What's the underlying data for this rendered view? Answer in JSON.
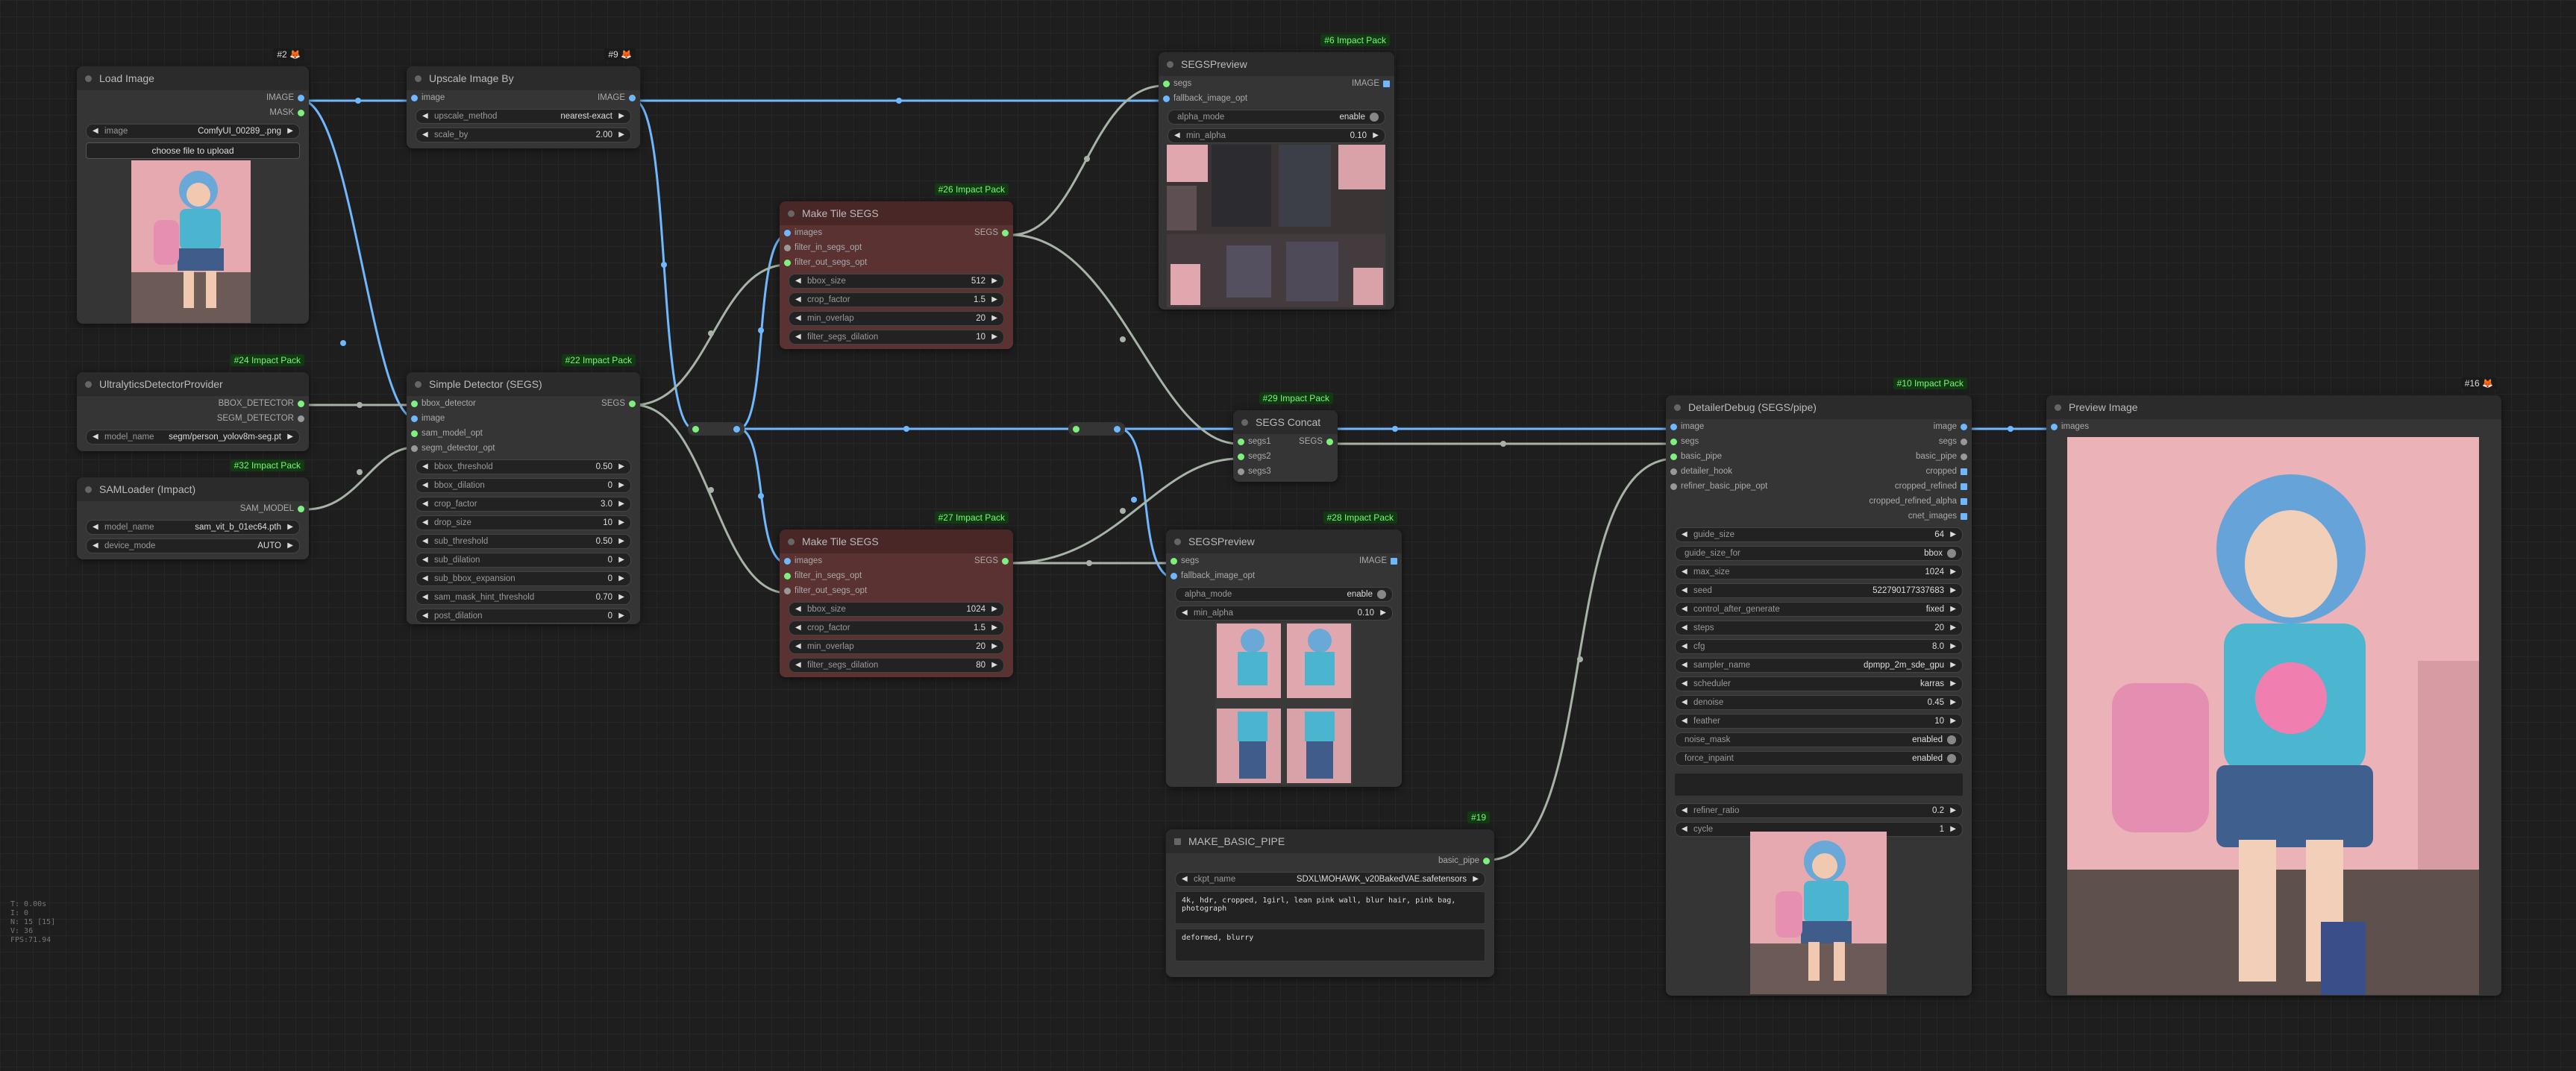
{
  "nodes": {
    "load_image": {
      "title": "Load Image",
      "badge": "#2 🦊",
      "outputs": [
        "IMAGE",
        "MASK"
      ],
      "image_label": "image",
      "image_value": "ComfyUI_00289_.png",
      "upload_label": "choose file to upload"
    },
    "upscale": {
      "title": "Upscale Image By",
      "badge": "#9 🦊",
      "input": "image",
      "output": "IMAGE",
      "widgets": [
        {
          "label": "upscale_method",
          "value": "nearest-exact"
        },
        {
          "label": "scale_by",
          "value": "2.00"
        }
      ]
    },
    "ultra": {
      "title": "UltralyticsDetectorProvider",
      "badge": "#24 Impact Pack",
      "outputs": [
        "BBOX_DETECTOR",
        "SEGM_DETECTOR"
      ],
      "widgets": [
        {
          "label": "model_name",
          "value": "segm/person_yolov8m-seg.pt"
        }
      ]
    },
    "samloader": {
      "title": "SAMLoader (Impact)",
      "badge": "#32 Impact Pack",
      "output": "SAM_MODEL",
      "widgets": [
        {
          "label": "model_name",
          "value": "sam_vit_b_01ec64.pth"
        },
        {
          "label": "device_mode",
          "value": "AUTO"
        }
      ]
    },
    "simple_detector": {
      "title": "Simple Detector (SEGS)",
      "badge": "#22 Impact Pack",
      "inputs": [
        "bbox_detector",
        "image",
        "sam_model_opt",
        "segm_detector_opt"
      ],
      "output": "SEGS",
      "widgets": [
        {
          "label": "bbox_threshold",
          "value": "0.50"
        },
        {
          "label": "bbox_dilation",
          "value": "0"
        },
        {
          "label": "crop_factor",
          "value": "3.0"
        },
        {
          "label": "drop_size",
          "value": "10"
        },
        {
          "label": "sub_threshold",
          "value": "0.50"
        },
        {
          "label": "sub_dilation",
          "value": "0"
        },
        {
          "label": "sub_bbox_expansion",
          "value": "0"
        },
        {
          "label": "sam_mask_hint_threshold",
          "value": "0.70"
        },
        {
          "label": "post_dilation",
          "value": "0"
        }
      ]
    },
    "tile1": {
      "title": "Make Tile SEGS",
      "badge": "#26 Impact Pack",
      "inputs": [
        "images",
        "filter_in_segs_opt",
        "filter_out_segs_opt"
      ],
      "output": "SEGS",
      "widgets": [
        {
          "label": "bbox_size",
          "value": "512"
        },
        {
          "label": "crop_factor",
          "value": "1.5"
        },
        {
          "label": "min_overlap",
          "value": "20"
        },
        {
          "label": "filter_segs_dilation",
          "value": "10"
        }
      ]
    },
    "tile2": {
      "title": "Make Tile SEGS",
      "badge": "#27 Impact Pack",
      "inputs": [
        "images",
        "filter_in_segs_opt",
        "filter_out_segs_opt"
      ],
      "output": "SEGS",
      "widgets": [
        {
          "label": "bbox_size",
          "value": "1024"
        },
        {
          "label": "crop_factor",
          "value": "1.5"
        },
        {
          "label": "min_overlap",
          "value": "20"
        },
        {
          "label": "filter_segs_dilation",
          "value": "80"
        }
      ]
    },
    "segs_prev1": {
      "title": "SEGSPreview",
      "badge": "#6 Impact Pack",
      "inputs": [
        "segs",
        "fallback_image_opt"
      ],
      "output": "IMAGE",
      "widgets": [
        {
          "label": "alpha_mode",
          "value": "enable"
        },
        {
          "label": "min_alpha",
          "value": "0.10"
        }
      ]
    },
    "segs_prev2": {
      "title": "SEGSPreview",
      "badge": "#28 Impact Pack",
      "inputs": [
        "segs",
        "fallback_image_opt"
      ],
      "output": "IMAGE",
      "widgets": [
        {
          "label": "alpha_mode",
          "value": "enable"
        },
        {
          "label": "min_alpha",
          "value": "0.10"
        }
      ]
    },
    "segs_concat": {
      "title": "SEGS Concat",
      "badge": "#29 Impact Pack",
      "inputs": [
        "segs1",
        "segs2",
        "segs3"
      ],
      "output": "SEGS"
    },
    "basic_pipe": {
      "title": "MAKE_BASIC_PIPE",
      "badge": "#19",
      "output": "basic_pipe",
      "widgets": [
        {
          "label": "ckpt_name",
          "value": "SDXL\\MOHAWK_v20BakedVAE.safetensors"
        }
      ],
      "positive": "4k, hdr, cropped, 1girl, lean pink wall, blur hair, pink bag, photograph",
      "negative": "deformed, blurry"
    },
    "detailer": {
      "title": "DetailerDebug (SEGS/pipe)",
      "badge": "#10 Impact Pack",
      "inputs": [
        "image",
        "segs",
        "basic_pipe",
        "detailer_hook",
        "refiner_basic_pipe_opt"
      ],
      "outputs": [
        "image",
        "segs",
        "basic_pipe",
        "cropped",
        "cropped_refined",
        "cropped_refined_alpha",
        "cnet_images"
      ],
      "widgets": [
        {
          "label": "guide_size",
          "value": "64"
        },
        {
          "label": "guide_size_for",
          "value": "bbox"
        },
        {
          "label": "max_size",
          "value": "1024"
        },
        {
          "label": "seed",
          "value": "522790177337683"
        },
        {
          "label": "control_after_generate",
          "value": "fixed"
        },
        {
          "label": "steps",
          "value": "20"
        },
        {
          "label": "cfg",
          "value": "8.0"
        },
        {
          "label": "sampler_name",
          "value": "dpmpp_2m_sde_gpu"
        },
        {
          "label": "scheduler",
          "value": "karras"
        },
        {
          "label": "denoise",
          "value": "0.45"
        },
        {
          "label": "feather",
          "value": "10"
        },
        {
          "label": "noise_mask",
          "value": "enabled"
        },
        {
          "label": "force_inpaint",
          "value": "enabled"
        }
      ],
      "widgets2": [
        {
          "label": "refiner_ratio",
          "value": "0.2"
        },
        {
          "label": "cycle",
          "value": "1"
        }
      ]
    },
    "preview": {
      "title": "Preview Image",
      "badge": "#16 🦊",
      "input": "images"
    }
  },
  "stats": [
    "T: 0.00s",
    "I: 0",
    "N: 15 [15]",
    "V: 36",
    "FPS:71.94"
  ],
  "colors": {
    "image_link": "#6fb7ff",
    "segs_link": "#a7b3a7",
    "background": "#1e1e1e"
  }
}
